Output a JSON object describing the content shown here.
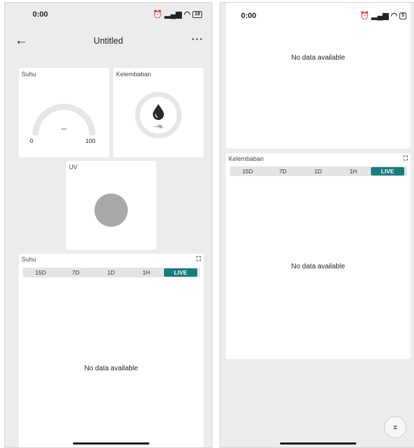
{
  "left": {
    "status": {
      "time": "0:00",
      "battery": "18"
    },
    "appbar": {
      "back_icon": "arrow-left-icon",
      "title": "Untitled",
      "more_icon": "more-horizontal-icon"
    },
    "cards": {
      "suhu": {
        "label": "Suhu",
        "value": "--",
        "min": "0",
        "max": "100"
      },
      "kelembaban": {
        "label": "Kelembaban",
        "value": "--%",
        "icon": "water-drop-icon"
      },
      "uv": {
        "label": "UV",
        "indicator_color": "#a9a9a9"
      }
    },
    "chart": {
      "label": "Suhu",
      "ranges": [
        "15D",
        "7D",
        "1D",
        "1H",
        "LIVE"
      ],
      "selected_range": "LIVE",
      "empty_text": "No data available"
    }
  },
  "right": {
    "status": {
      "time": "0:00",
      "battery": "5"
    },
    "top_chart": {
      "empty_text": "No data available"
    },
    "chart": {
      "label": "Kelembaban",
      "ranges": [
        "15D",
        "7D",
        "1D",
        "1H",
        "LIVE"
      ],
      "selected_range": "LIVE",
      "empty_text": "No data available"
    },
    "scroll_top_icon": "chevron-up-to-top-icon"
  },
  "colors": {
    "accent": "#177c7f",
    "background": "#ececec",
    "card": "#ffffff",
    "gauge_track": "#e6e6e6"
  }
}
